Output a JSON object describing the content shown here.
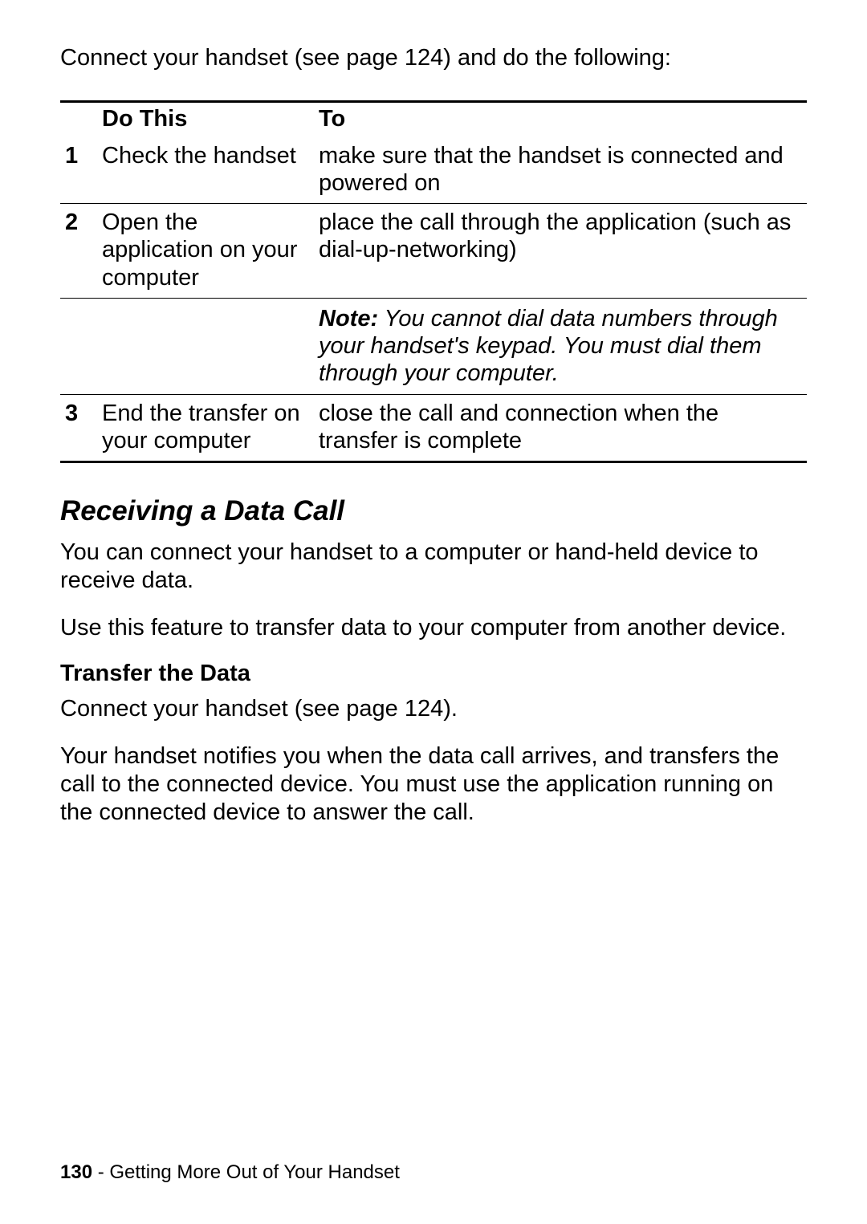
{
  "intro": "Connect your handset (see page 124) and do the following:",
  "table": {
    "header": {
      "num": "",
      "action": "Do This",
      "result": "To"
    },
    "rows": [
      {
        "num": "1",
        "action": "Check the handset",
        "result": "make sure that the handset is connected and powered on"
      },
      {
        "num": "2",
        "action": "Open the application on your computer",
        "result": "place the call through the application (such as dial-up-networking)"
      },
      {
        "num": "3",
        "action": "End the transfer on your computer",
        "result": "close the call and connection when the transfer is complete"
      }
    ],
    "note": {
      "label": "Note:",
      "text": " You cannot dial data numbers through your handset's keypad. You must dial them through your computer."
    }
  },
  "section": {
    "heading": "Receiving a Data Call",
    "para1": "You can connect your handset to a computer or hand-held device to receive data.",
    "para2": "Use this feature to transfer data to your computer from another device.",
    "subhead": "Transfer the Data",
    "para3": "Connect your handset (see page 124).",
    "para4": "Your handset notifies you when the data call arrives, and transfers the call to the connected device. You must use the application running on the connected device to answer the call."
  },
  "footer": {
    "page": "130",
    "sep": " - ",
    "title": "Getting More Out of Your Handset"
  }
}
